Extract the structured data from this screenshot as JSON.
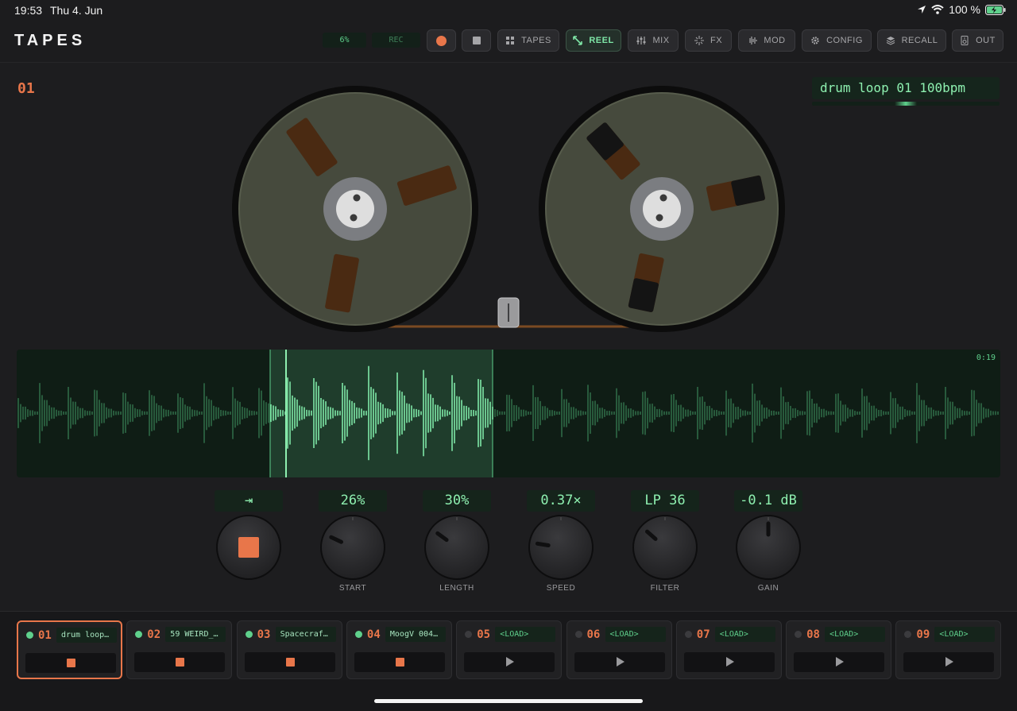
{
  "status_bar": {
    "time": "19:53",
    "date": "Thu 4. Jun",
    "battery": "100 %"
  },
  "header": {
    "app_title": "TAPES",
    "level_readout": "6%",
    "rec_indicator": "REC",
    "buttons": {
      "tapes": "TAPES",
      "reel": "REEL",
      "mix": "MIX",
      "fx": "FX",
      "mod": "MOD",
      "config": "CONFIG",
      "recall": "RECALL",
      "out": "OUT"
    },
    "active_tab": "REEL"
  },
  "reel_view": {
    "track_number": "01",
    "tape_name": "drum loop 01 100bpm",
    "tape_position": 0.5
  },
  "waveform": {
    "time_label": "0:19",
    "selection_start": 0.26,
    "selection_length": 0.3,
    "playhead": 0.275
  },
  "controls": [
    {
      "key": "mode",
      "value": "⇥",
      "label": ""
    },
    {
      "key": "start",
      "value": "26%",
      "label": "START",
      "level": 0.26
    },
    {
      "key": "length",
      "value": "30%",
      "label": "LENGTH",
      "level": 0.3
    },
    {
      "key": "speed",
      "value": "0.37×",
      "label": "SPEED",
      "level": 0.2
    },
    {
      "key": "filter",
      "value": "LP 36",
      "label": "FILTER",
      "level": 0.32
    },
    {
      "key": "gain",
      "value": "-0.1 dB",
      "label": "GAIN",
      "level": 0.5
    }
  ],
  "slots": [
    {
      "num": "01",
      "name": "drum loop…",
      "loaded": true,
      "state": "stop",
      "selected": true
    },
    {
      "num": "02",
      "name": "59 WEIRD_…",
      "loaded": true,
      "state": "stop"
    },
    {
      "num": "03",
      "name": "Spacecraf…",
      "loaded": true,
      "state": "stop"
    },
    {
      "num": "04",
      "name": "MoogV 004…",
      "loaded": true,
      "state": "stop"
    },
    {
      "num": "05",
      "name": "<LOAD>",
      "loaded": false,
      "state": "play"
    },
    {
      "num": "06",
      "name": "<LOAD>",
      "loaded": false,
      "state": "play"
    },
    {
      "num": "07",
      "name": "<LOAD>",
      "loaded": false,
      "state": "play"
    },
    {
      "num": "08",
      "name": "<LOAD>",
      "loaded": false,
      "state": "play"
    },
    {
      "num": "09",
      "name": "<LOAD>",
      "loaded": false,
      "state": "play"
    }
  ],
  "colors": {
    "accent": "#e8764a",
    "green": "#5fd08c",
    "green_bright": "#8ef0b0"
  }
}
